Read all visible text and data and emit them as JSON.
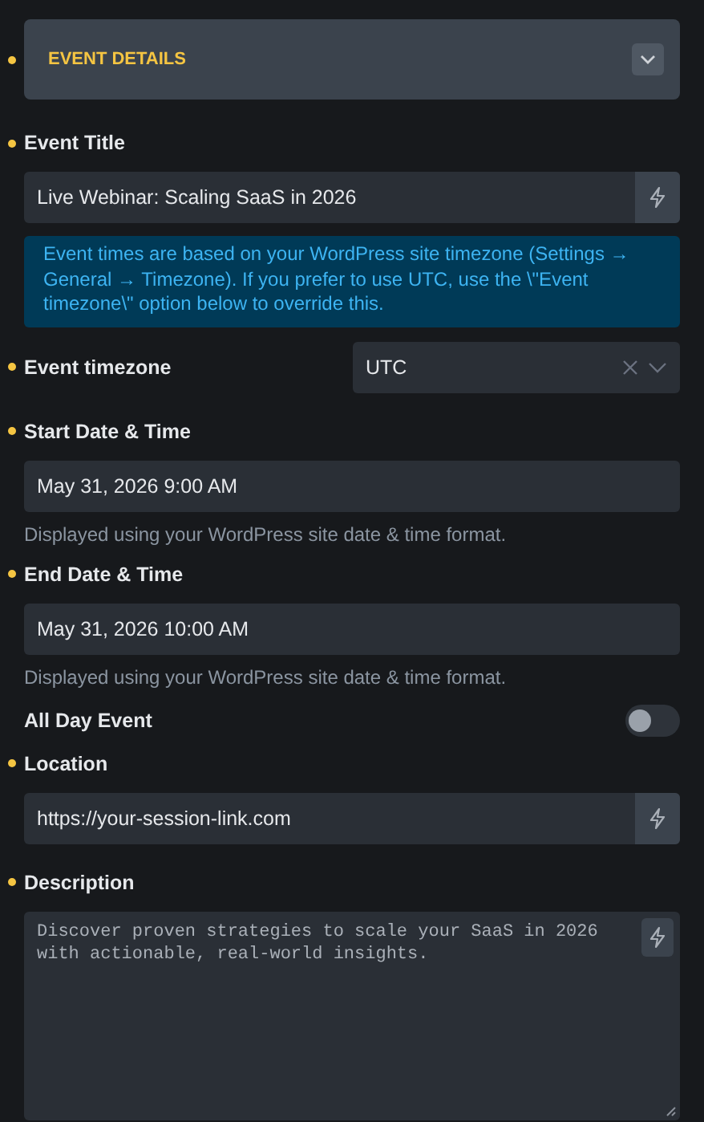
{
  "section": {
    "title": "EVENT DETAILS",
    "marked": true
  },
  "fields": [
    {
      "kind": "text",
      "label": "Event Title",
      "marked": true,
      "value": "Live Webinar: Scaling SaaS in 2026"
    },
    {
      "kind": "notice",
      "text": "Event times are based on your WordPress site timezone (Settings → General → Timezone). If you prefer to use UTC, use the \\\"Event timezone\\\" option below to override this."
    },
    {
      "kind": "select",
      "label": "Event timezone",
      "marked": true,
      "value": "UTC"
    },
    {
      "kind": "date",
      "label": "Start Date & Time",
      "marked": true,
      "value": "May 31, 2026 9:00 AM",
      "help": "Displayed using your WordPress site date & time format."
    },
    {
      "kind": "date",
      "label": "End Date & Time",
      "marked": true,
      "value": "May 31, 2026 10:00 AM",
      "help": "Displayed using your WordPress site date & time format."
    },
    {
      "kind": "toggle",
      "label": "All Day Event",
      "marked": false,
      "on": false
    },
    {
      "kind": "text",
      "label": "Location",
      "marked": true,
      "value": "https://your-session-link.com"
    },
    {
      "kind": "textarea",
      "label": "Description",
      "marked": true,
      "value": "Discover proven strategies to scale your SaaS in 2026 with actionable, real-world insights."
    }
  ]
}
